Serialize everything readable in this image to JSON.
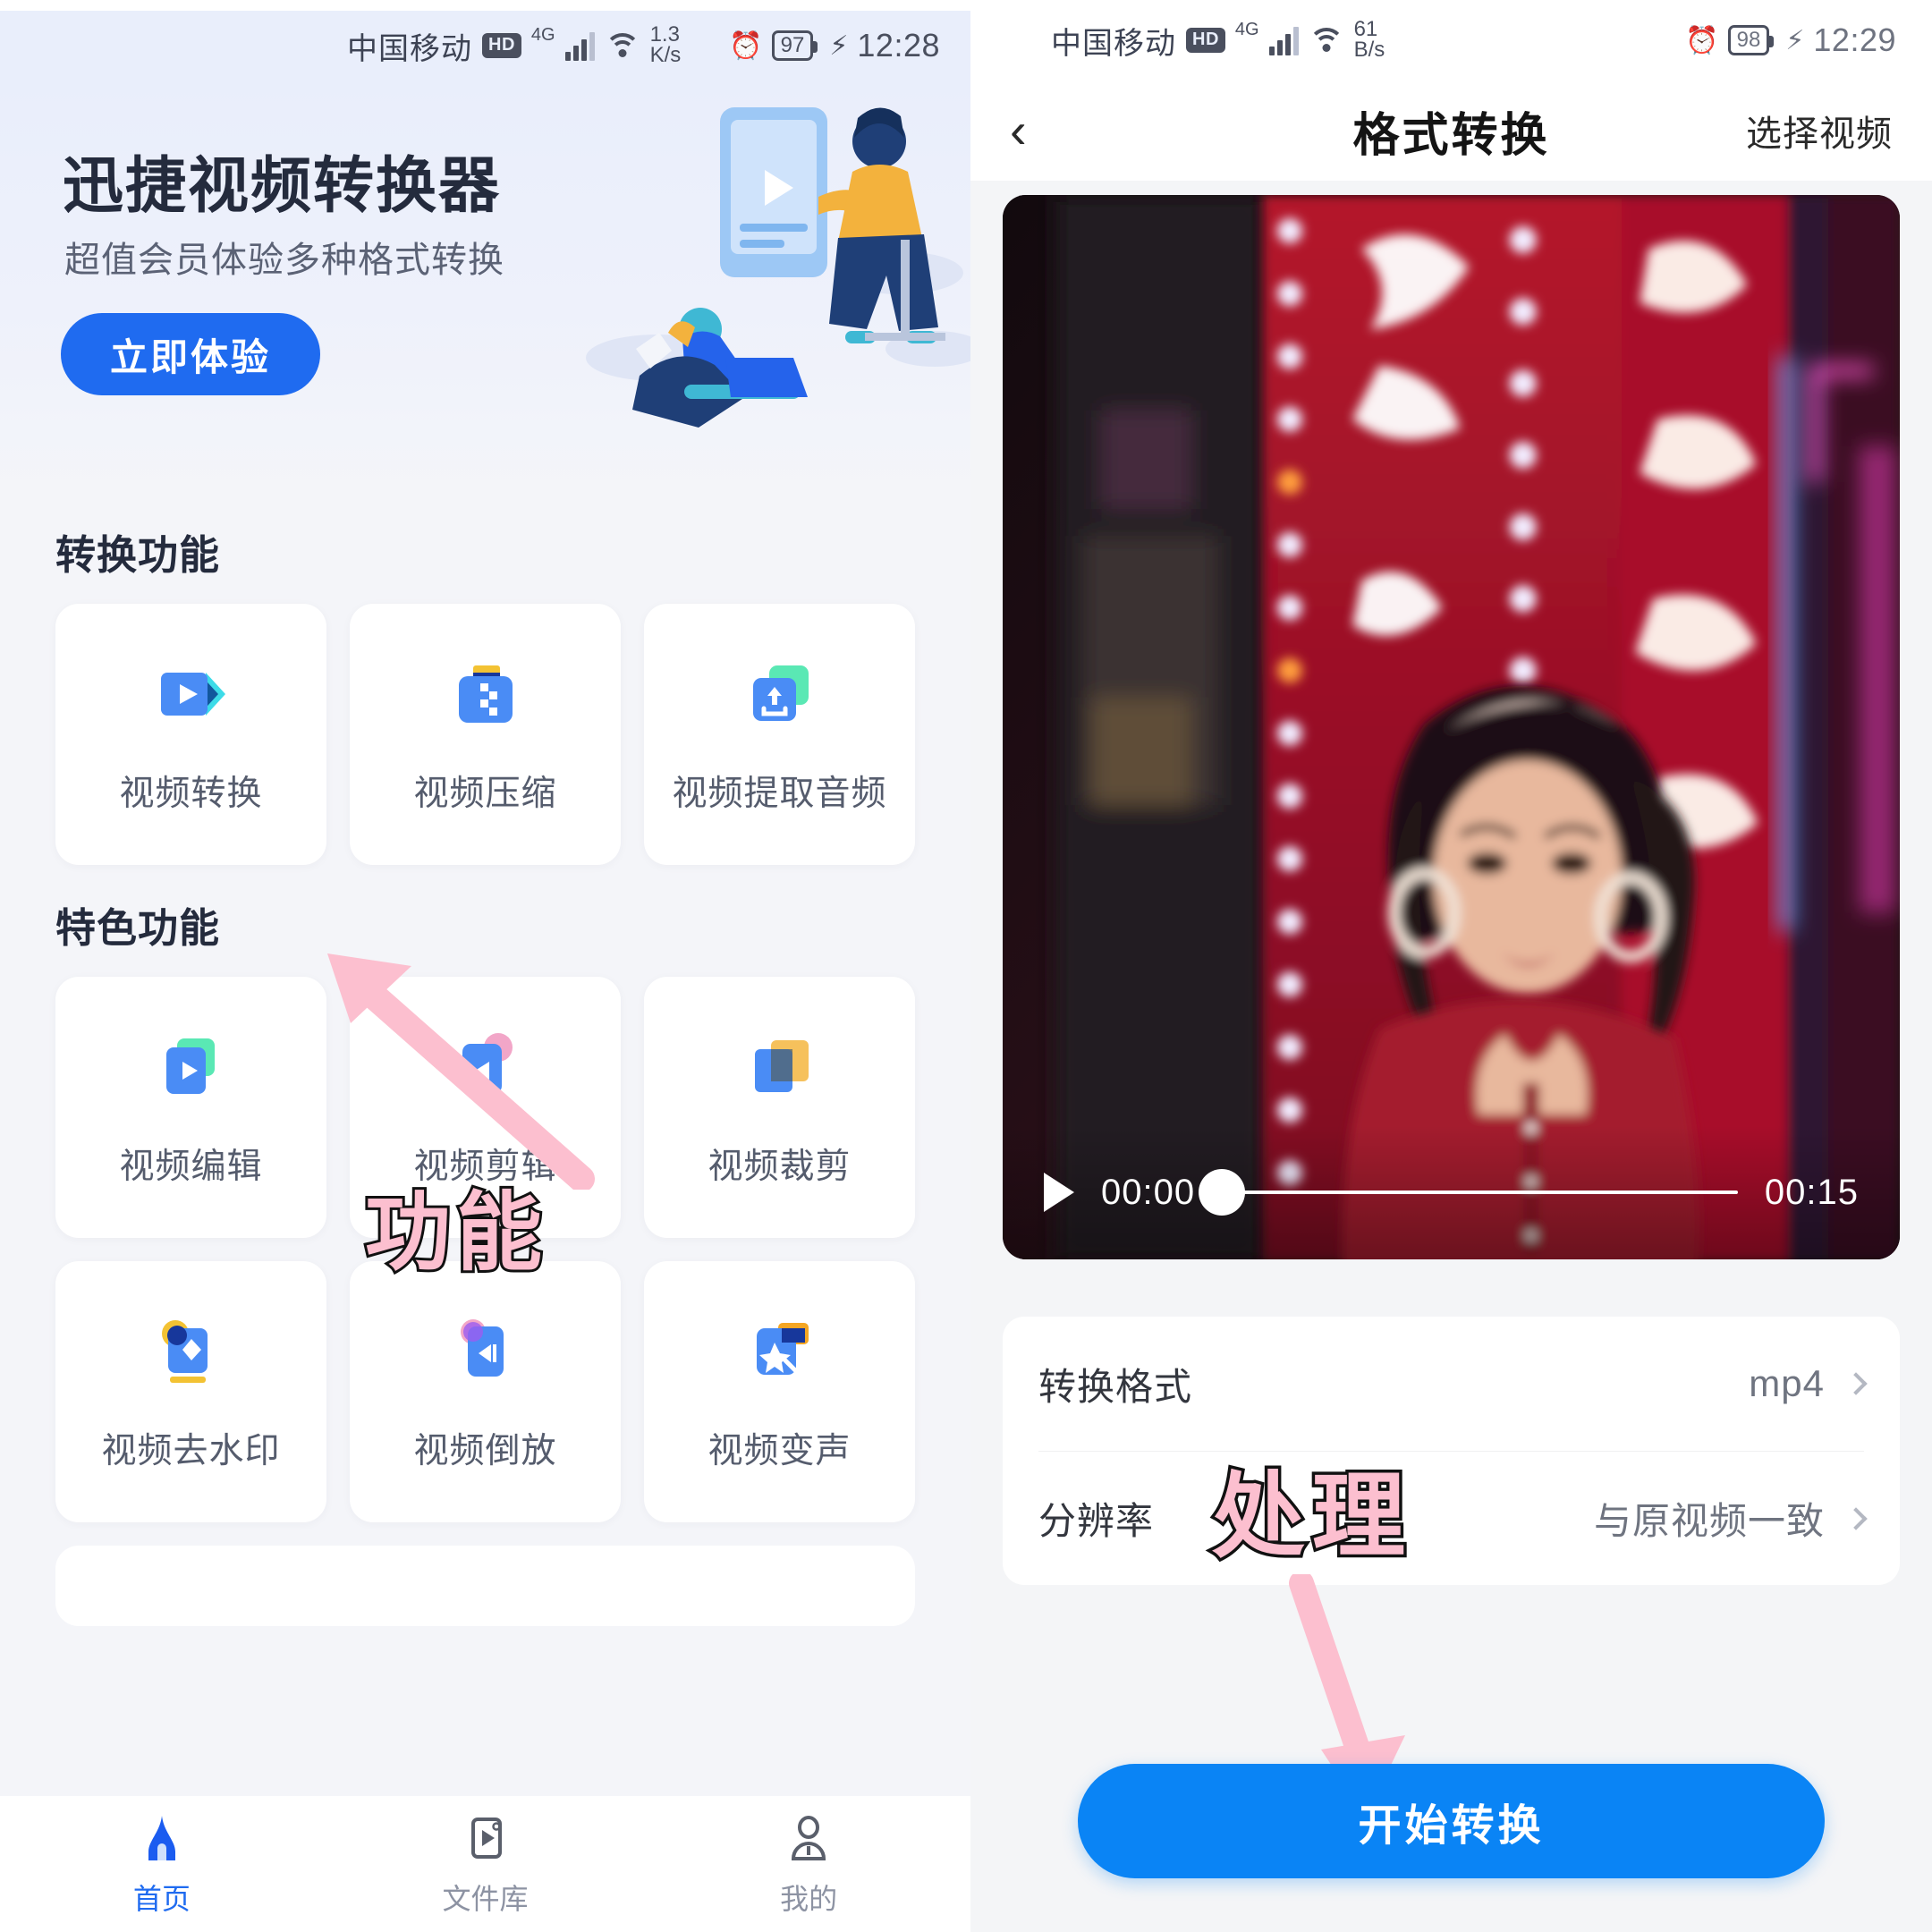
{
  "left_phone": {
    "status_bar": {
      "carrier": "中国移动",
      "hd_badge": "HD",
      "network": "4G",
      "net_speed_value": "1.3",
      "net_speed_unit": "K/s",
      "battery": "97",
      "time": "12:28"
    },
    "banner": {
      "title": "迅捷视频转换器",
      "subtitle": "超值会员体验多种格式转换",
      "cta_label": "立即体验"
    },
    "sections": [
      {
        "title": "转换功能",
        "cards": [
          {
            "label": "视频转换",
            "icon": "video-convert-icon"
          },
          {
            "label": "视频压缩",
            "icon": "video-compress-icon"
          },
          {
            "label": "视频提取音频",
            "icon": "video-extract-audio-icon"
          }
        ]
      },
      {
        "title": "特色功能",
        "cards": [
          {
            "label": "视频编辑",
            "icon": "video-edit-icon"
          },
          {
            "label": "视频剪辑",
            "icon": "video-trim-icon"
          },
          {
            "label": "视频裁剪",
            "icon": "video-crop-icon"
          }
        ]
      }
    ],
    "extra_cards": [
      {
        "label": "视频去水印",
        "icon": "video-watermark-remove-icon"
      },
      {
        "label": "视频倒放",
        "icon": "video-reverse-icon"
      },
      {
        "label": "视频变声",
        "icon": "video-voice-change-icon"
      }
    ],
    "tabbar": [
      {
        "label": "首页",
        "icon": "home-icon",
        "active": true
      },
      {
        "label": "文件库",
        "icon": "file-library-icon",
        "active": false
      },
      {
        "label": "我的",
        "icon": "profile-icon",
        "active": false
      }
    ],
    "annotation": {
      "text": "功能"
    }
  },
  "right_phone": {
    "status_bar": {
      "carrier": "中国移动",
      "hd_badge": "HD",
      "network": "4G",
      "net_speed_value": "61",
      "net_speed_unit": "B/s",
      "battery": "98",
      "time": "12:29"
    },
    "navbar": {
      "back_icon": "chevron-left-icon",
      "title": "格式转换",
      "action_label": "选择视频"
    },
    "player": {
      "current_time": "00:00",
      "duration": "00:15",
      "progress_percent": 0,
      "play_icon": "play-icon"
    },
    "settings": [
      {
        "label": "转换格式",
        "value": "mp4"
      },
      {
        "label": "分辨率",
        "value": "与原视频一致"
      }
    ],
    "start_button_label": "开始转换",
    "annotation": {
      "text": "处理"
    }
  },
  "colors": {
    "accent_blue": "#1f6bf0",
    "button_blue": "#0a84f5",
    "annotation_pink": "#fcbfcf",
    "page_bg": "#f4f5f9",
    "card_bg": "#ffffff"
  }
}
